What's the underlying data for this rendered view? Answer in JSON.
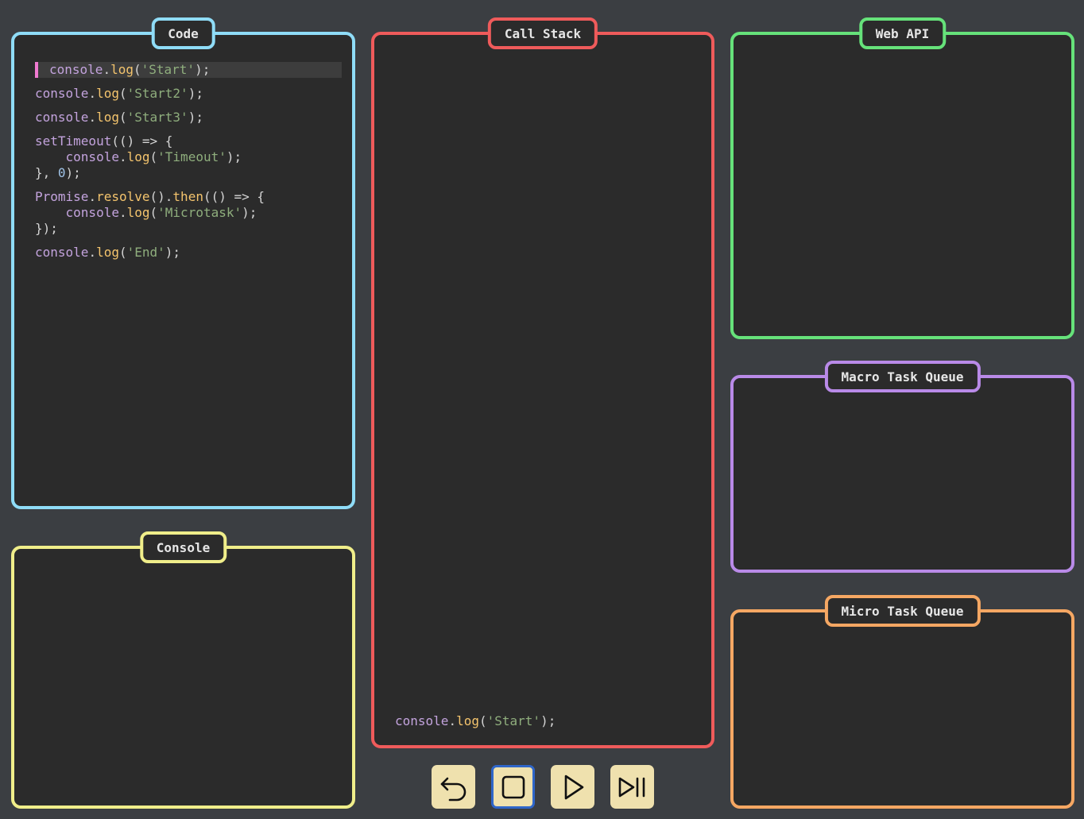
{
  "panels": {
    "code": "Code",
    "console": "Console",
    "call_stack": "Call Stack",
    "web_api": "Web API",
    "macro_queue": "Macro Task Queue",
    "micro_queue": "Micro Task Queue"
  },
  "code": {
    "l1": {
      "obj": "console",
      "dot": ".",
      "fn": "log",
      "open": "(",
      "str": "'Start'",
      "close": ");"
    },
    "l2": {
      "obj": "console",
      "dot": ".",
      "fn": "log",
      "open": "(",
      "str": "'Start2'",
      "close": ");"
    },
    "l3": {
      "obj": "console",
      "dot": ".",
      "fn": "log",
      "open": "(",
      "str": "'Start3'",
      "close": ");"
    },
    "l4a": {
      "fn": "setTimeout",
      "rest": "(() => {"
    },
    "l4b": {
      "indent": "    ",
      "obj": "console",
      "dot": ".",
      "fn": "log",
      "open": "(",
      "str": "'Timeout'",
      "close": ");"
    },
    "l4c": {
      "pre": "}, ",
      "num": "0",
      "post": ");"
    },
    "l5a": {
      "obj": "Promise",
      "dot": ".",
      "fn": "resolve",
      "mid": "().",
      "fn2": "then",
      "rest": "(() => {"
    },
    "l5b": {
      "indent": "    ",
      "obj": "console",
      "dot": ".",
      "fn": "log",
      "open": "(",
      "str": "'Microtask'",
      "close": ");"
    },
    "l5c": {
      "text": "});"
    },
    "l6": {
      "obj": "console",
      "dot": ".",
      "fn": "log",
      "open": "(",
      "str": "'End'",
      "close": ");"
    }
  },
  "call_stack_items": [
    {
      "obj": "console",
      "dot": ".",
      "fn": "log",
      "open": "(",
      "str": "'Start'",
      "close": ");"
    }
  ],
  "controls": [
    "undo-icon",
    "stop-icon",
    "play-icon",
    "step-icon"
  ],
  "colors": {
    "code": "#8fdcf7",
    "console": "#f0ee8a",
    "call_stack": "#ef5b5b",
    "web_api": "#66e27a",
    "macro_queue": "#b98ae8",
    "micro_queue": "#f5a763",
    "current_line_marker": "#f07ad0",
    "control_bg": "#efe1ae",
    "control_active_border": "#2f66c9"
  }
}
